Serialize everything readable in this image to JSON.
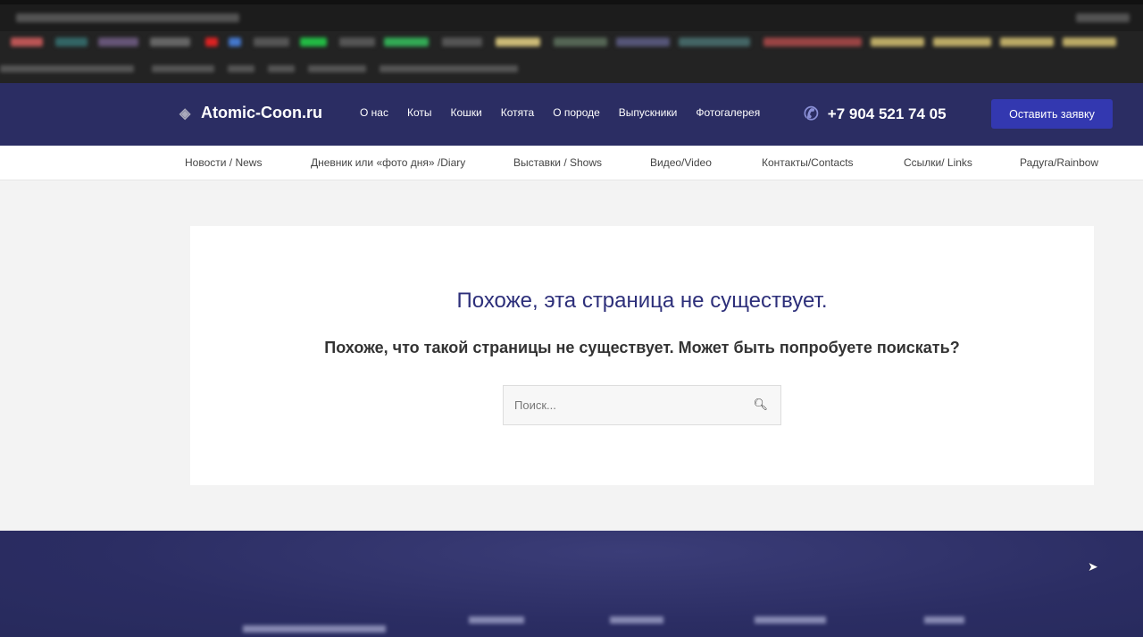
{
  "header": {
    "logo": "Atomic-Coon.ru",
    "nav": [
      "О нас",
      "Коты",
      "Кошки",
      "Котята",
      "О породе",
      "Выпускники",
      "Фотогалерея"
    ],
    "phone": "+7 904 521 74 05",
    "cta": "Оставить заявку"
  },
  "subnav": [
    "Новости / News",
    "Дневник или «фото дня» /Diary",
    "Выставки / Shows",
    "Видео/Video",
    "Контакты/Contacts",
    "Ссылки/ Links",
    "Радуга/Rainbow"
  ],
  "main": {
    "title": "Похоже, эта страница не существует.",
    "subtitle": "Похоже, что такой страницы не существует. Может быть попробуете поискать?",
    "search_placeholder": "Поиск..."
  },
  "colors": {
    "header": "#2b2d63",
    "accent": "#3338b0",
    "title": "#2d2f7a"
  }
}
